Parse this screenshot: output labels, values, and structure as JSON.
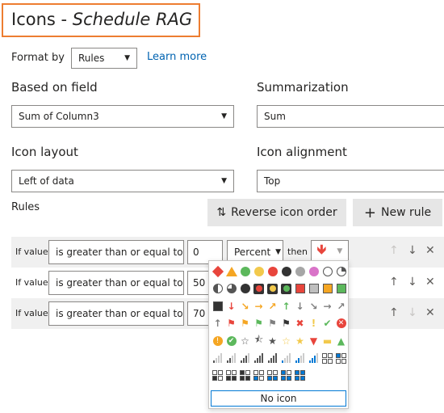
{
  "title": {
    "main": "Icons - ",
    "italic": "Schedule RAG"
  },
  "format_by": {
    "label": "Format by",
    "value": "Rules",
    "learn_more": "Learn more"
  },
  "based_on_field": {
    "label": "Based on field",
    "value": "Sum of Column3"
  },
  "summarization": {
    "label": "Summarization",
    "value": "Sum"
  },
  "icon_layout": {
    "label": "Icon layout",
    "value": "Left of data"
  },
  "icon_alignment": {
    "label": "Icon alignment",
    "value": "Top"
  },
  "rules": {
    "label": "Rules",
    "reverse_label": "Reverse icon order",
    "new_rule_label": "New rule",
    "rows": [
      {
        "if_label": "If value",
        "operator": "is greater than or equal to",
        "value": "0",
        "unit": "Percent",
        "then": "then"
      },
      {
        "if_label": "If value",
        "operator": "is greater than or equal to",
        "value": "50"
      },
      {
        "if_label": "If value",
        "operator": "is greater than or equal to",
        "value": "70"
      }
    ]
  },
  "icon_picker": {
    "no_icon_label": "No icon"
  },
  "colors": {
    "accent": "#0078d4",
    "title_border": "#ed7d31",
    "red": "#e8453c",
    "orange": "#f5a623",
    "green": "#5cb85c",
    "yellow": "#f2c94c",
    "gray": "#7f7f7f"
  }
}
